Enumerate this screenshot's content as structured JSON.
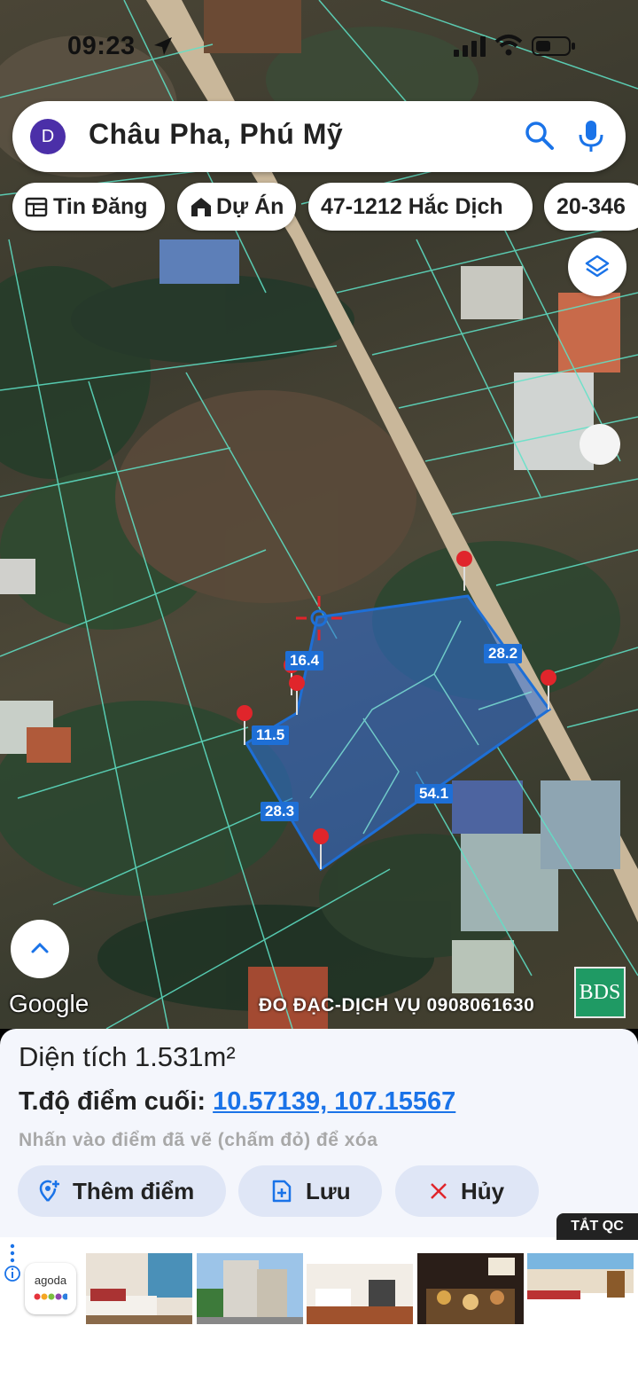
{
  "status_bar": {
    "time": "09:23"
  },
  "search": {
    "avatar_letter": "D",
    "query": "Châu Pha, Phú Mỹ"
  },
  "chips": [
    {
      "label": "Tin Đăng",
      "icon": "calendar-icon"
    },
    {
      "label": "Dự Án",
      "icon": "house-icon"
    },
    {
      "label": "47-1212 Hắc Dịch"
    },
    {
      "label": "20-346"
    }
  ],
  "map": {
    "segment_labels": [
      "16.4",
      "28.2",
      "11.5",
      "28.3",
      "54.1"
    ],
    "google_label": "Google",
    "watermark": "ĐO ĐẠC-DỊCH VỤ 0908061630",
    "logo_text": "BDS",
    "colors": {
      "polygon_fill": "#2f6fd8",
      "polygon_stroke": "#1e6fd6",
      "parcel_lines": "#5fe3c8",
      "pin": "#e0252b",
      "road": "#c9b79a"
    }
  },
  "panel": {
    "area": "Diện tích 1.531m²",
    "coord_label": "T.độ điểm cuối:",
    "coord_value": "10.57139, 107.15567",
    "hint": "Nhấn vào điểm đã vẽ (chấm đỏ) để xóa",
    "buttons": {
      "add": "Thêm điểm",
      "save": "Lưu",
      "cancel": "Hủy"
    }
  },
  "ads": {
    "tag": "TẮT QC",
    "brand": "agoda"
  }
}
